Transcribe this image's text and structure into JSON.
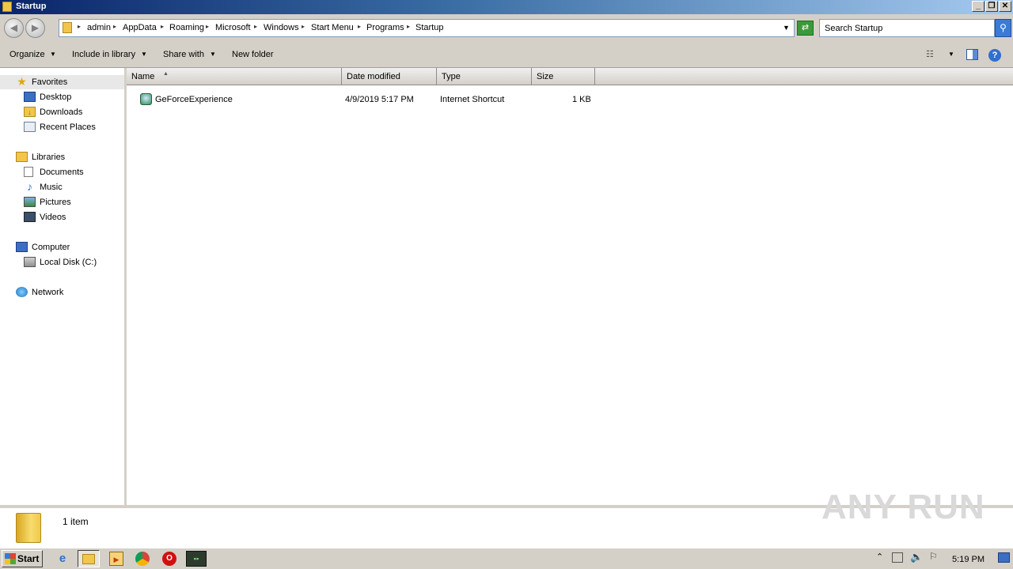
{
  "window": {
    "title": "Startup"
  },
  "address": {
    "crumbs": [
      "admin",
      "AppData",
      "Roaming",
      "Microsoft",
      "Windows",
      "Start Menu",
      "Programs",
      "Startup"
    ]
  },
  "search": {
    "placeholder": "Search Startup"
  },
  "toolbar": {
    "organize": "Organize",
    "include_in_library": "Include in library",
    "share_with": "Share with",
    "new_folder": "New folder"
  },
  "nav": {
    "favorites": "Favorites",
    "desktop": "Desktop",
    "downloads": "Downloads",
    "recent_places": "Recent Places",
    "libraries": "Libraries",
    "documents": "Documents",
    "music": "Music",
    "pictures": "Pictures",
    "videos": "Videos",
    "computer": "Computer",
    "local_disk": "Local Disk (C:)",
    "network": "Network"
  },
  "columns": {
    "name": "Name",
    "date_modified": "Date modified",
    "type": "Type",
    "size": "Size"
  },
  "files": [
    {
      "name": "GeForceExperience",
      "date_modified": "4/9/2019 5:17 PM",
      "type": "Internet Shortcut",
      "size": "1 KB"
    }
  ],
  "status": {
    "item_count": "1 item",
    "watermark": "ANY RUN"
  },
  "taskbar": {
    "start": "Start",
    "clock": "5:19 PM"
  },
  "colors": {
    "title_gradient_start": "#0a246a",
    "chrome": "#d4d0c8",
    "selection": "#e8e8e8"
  }
}
